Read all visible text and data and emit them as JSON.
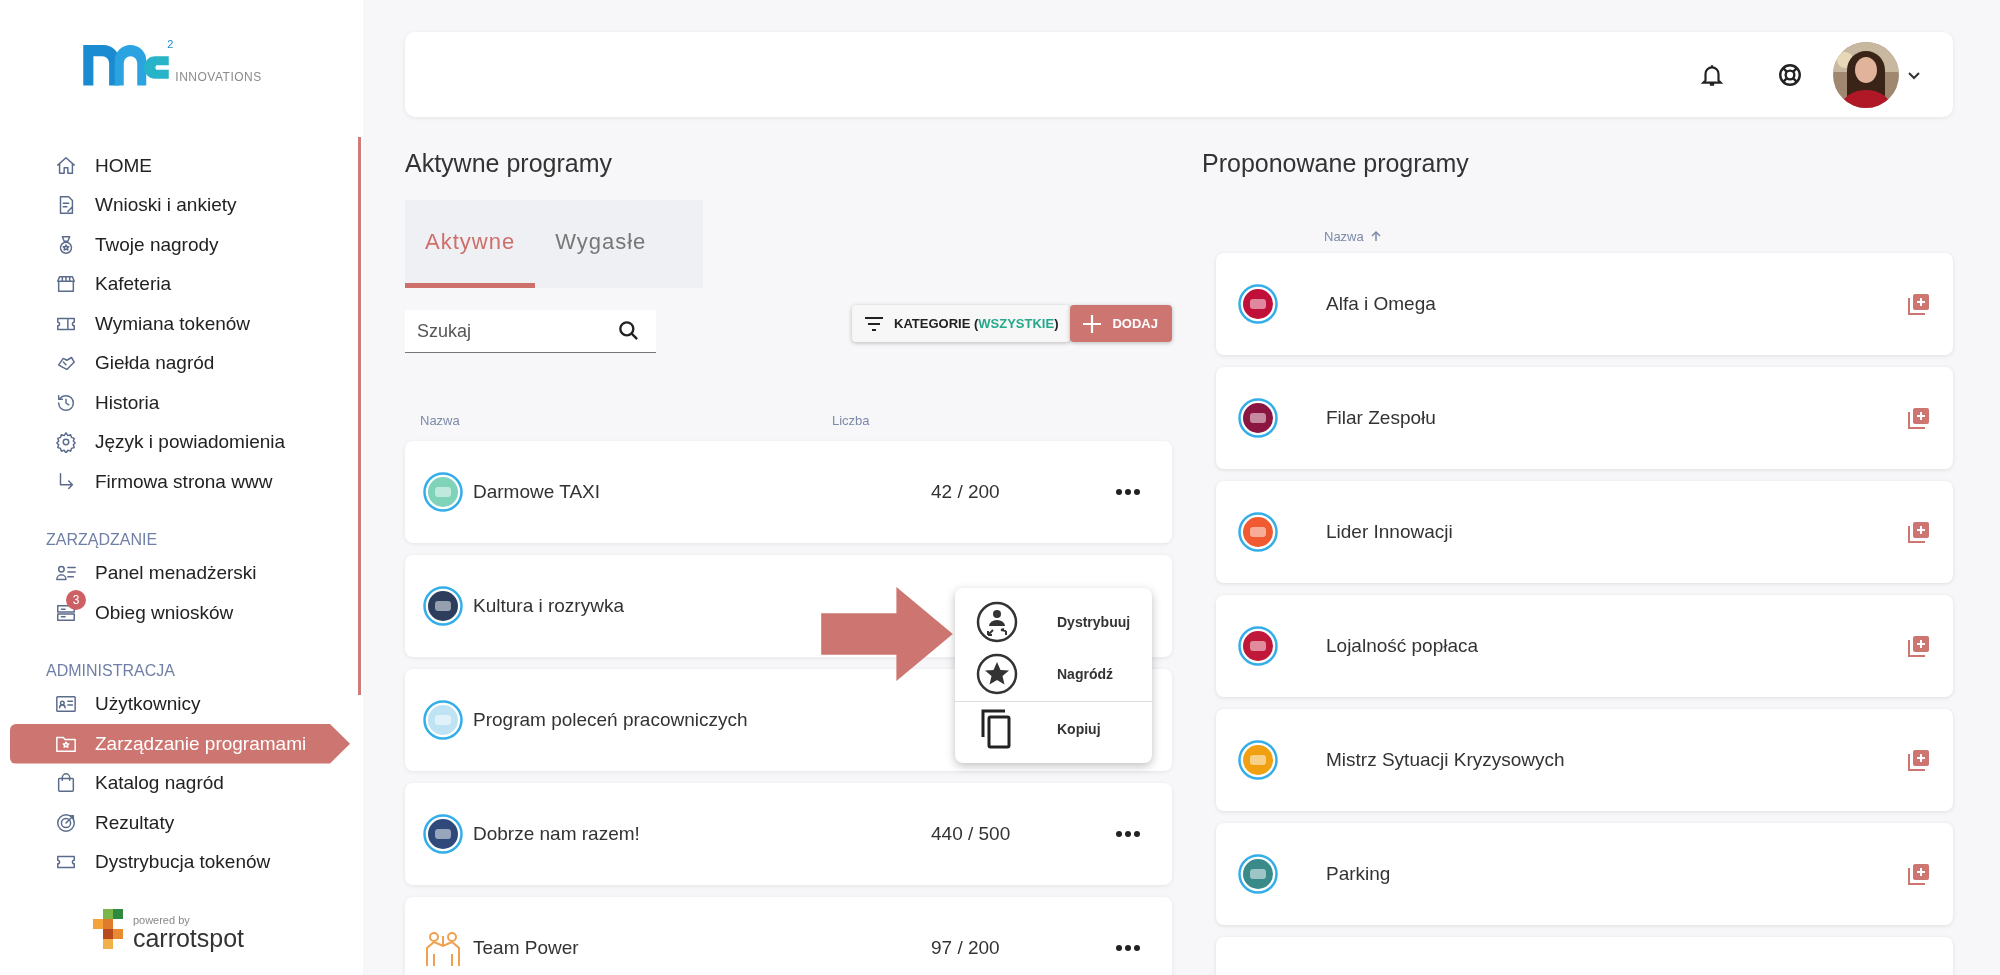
{
  "sidebar": {
    "logo": {
      "superscript": "2",
      "text": "INNOVATIONS"
    },
    "sections": [
      {
        "items": [
          {
            "label": "HOME",
            "selected": false
          },
          {
            "label": "Wnioski i ankiety",
            "selected": false
          },
          {
            "label": "Twoje nagrody",
            "selected": false
          },
          {
            "label": "Kafeteria",
            "selected": false
          },
          {
            "label": "Wymiana tokenów",
            "selected": false
          },
          {
            "label": "Giełda nagród",
            "selected": false
          },
          {
            "label": "Historia",
            "selected": false
          },
          {
            "label": "Język i powiadomienia",
            "selected": false
          },
          {
            "label": "Firmowa strona www",
            "selected": false
          }
        ]
      },
      {
        "heading": "ZARZĄDZANIE",
        "items": [
          {
            "label": "Panel menadżerski",
            "selected": false
          },
          {
            "label": "Obieg wniosków",
            "selected": false,
            "badge": "3"
          }
        ]
      },
      {
        "heading": "ADMINISTRACJA",
        "items": [
          {
            "label": "Użytkownicy",
            "selected": false
          },
          {
            "label": "Zarządzanie programami",
            "selected": true
          },
          {
            "label": "Katalog nagród",
            "selected": false
          },
          {
            "label": "Rezultaty",
            "selected": false
          },
          {
            "label": "Dystrybucja tokenów",
            "selected": false
          }
        ]
      }
    ],
    "footer": {
      "powered": "powered by",
      "brand": "carrotspot"
    }
  },
  "active_programs": {
    "title": "Aktywne programy",
    "tabs": [
      {
        "label": "Aktywne",
        "selected": true
      },
      {
        "label": "Wygasłe",
        "selected": false
      }
    ],
    "search": {
      "placeholder": "Szukaj"
    },
    "filter_button": {
      "label": "KATEGORIE (",
      "value": "WSZYSTKIE",
      "suffix": ")"
    },
    "add_button": {
      "label": "DODAJ"
    },
    "columns": [
      "Nazwa",
      "Liczba"
    ],
    "rows": [
      {
        "kind": "badge",
        "color": "#7fd3b8",
        "name": "Darmowe TAXI",
        "count": "42 / 200"
      },
      {
        "kind": "badge",
        "color": "#2d3e5c",
        "name": "Kultura i rozrywka"
      },
      {
        "kind": "badge",
        "color": "#bfe3f2",
        "name": "Program poleceń pracowniczych"
      },
      {
        "kind": "badge",
        "color": "#2f4a7a",
        "name": "Dobrze nam razem!",
        "count": "440 / 500"
      },
      {
        "kind": "outline",
        "color": "#f0a050",
        "name": "Team Power",
        "count": "97 / 200"
      }
    ],
    "menu": [
      {
        "kind": "distribute",
        "label": "Dystrybuuj"
      },
      {
        "kind": "reward",
        "label": "Nagródź"
      },
      {
        "kind": "copy",
        "label": "Kopiuj"
      }
    ]
  },
  "proposed_programs": {
    "title": "Proponowane programy",
    "column": "Nazwa",
    "sort_ascending": true,
    "items": [
      {
        "color": "#c0103a",
        "name": "Alfa i Omega"
      },
      {
        "color": "#8a1540",
        "name": "Filar Zespołu"
      },
      {
        "color": "#ef5a30",
        "name": "Lider Innowacji"
      },
      {
        "color": "#c01838",
        "name": "Lojalność popłaca"
      },
      {
        "color": "#f0a010",
        "name": "Mistrz Sytuacji Kryzysowych"
      },
      {
        "color": "#3a8a8a",
        "name": "Parking"
      }
    ]
  }
}
